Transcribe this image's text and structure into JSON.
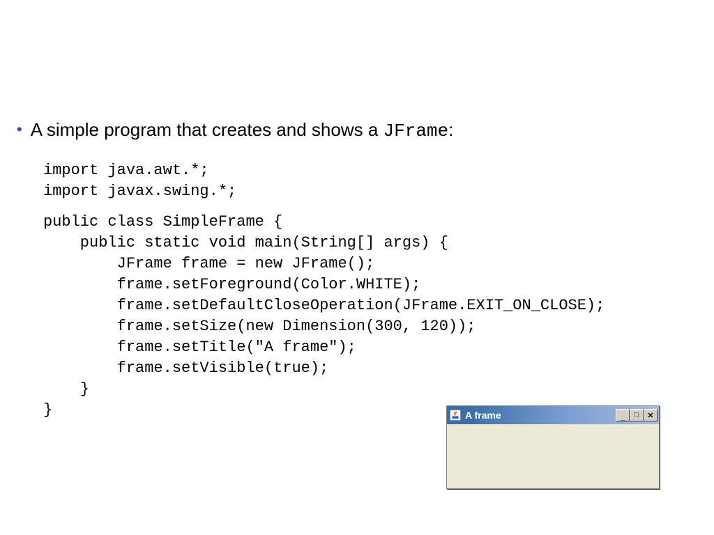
{
  "bullet": {
    "prefix": "A simple program that creates and shows a ",
    "code_word": "JFrame",
    "suffix": ":"
  },
  "code": {
    "l1": "import java.awt.*;",
    "l2": "import javax.swing.*;",
    "l3": "public class SimpleFrame {",
    "l4": "    public static void main(String[] args) {",
    "l5": "        JFrame frame = new JFrame();",
    "l6": "        frame.setForeground(Color.WHITE);",
    "l7": "        frame.setDefaultCloseOperation(JFrame.EXIT_ON_CLOSE);",
    "l8": "        frame.setSize(new Dimension(300, 120));",
    "l9": "        frame.setTitle(\"A frame\");",
    "l10": "        frame.setVisible(true);",
    "l11": "    }",
    "l12": "}"
  },
  "window": {
    "title": "A frame",
    "min_glyph": "_",
    "max_glyph": "□",
    "close_glyph": "✕"
  }
}
